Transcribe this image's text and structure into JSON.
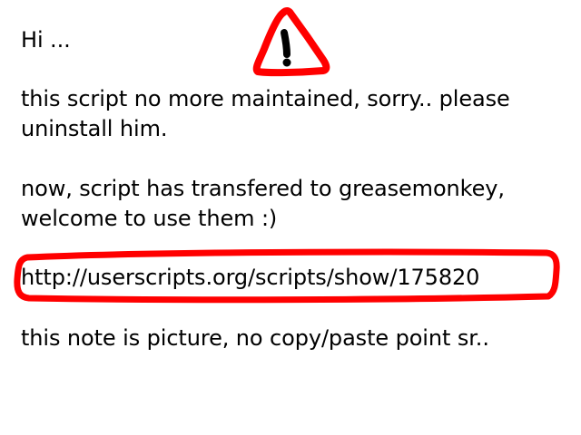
{
  "note": {
    "greeting": "Hi ...",
    "message1_line1": "this script no more maintained, sorry.. please",
    "message1_line2": "uninstall him.",
    "message2_line1": "now, script has transfered to greasemonkey,",
    "message2_line2": "welcome to use them :)",
    "url": "http://userscripts.org/scripts/show/175820",
    "footer": "this note is picture, no copy/paste point sr.."
  },
  "icons": {
    "warning": "warning-icon"
  },
  "colors": {
    "background": "#ffffff",
    "text": "#000000",
    "highlight": "#ff0000"
  }
}
